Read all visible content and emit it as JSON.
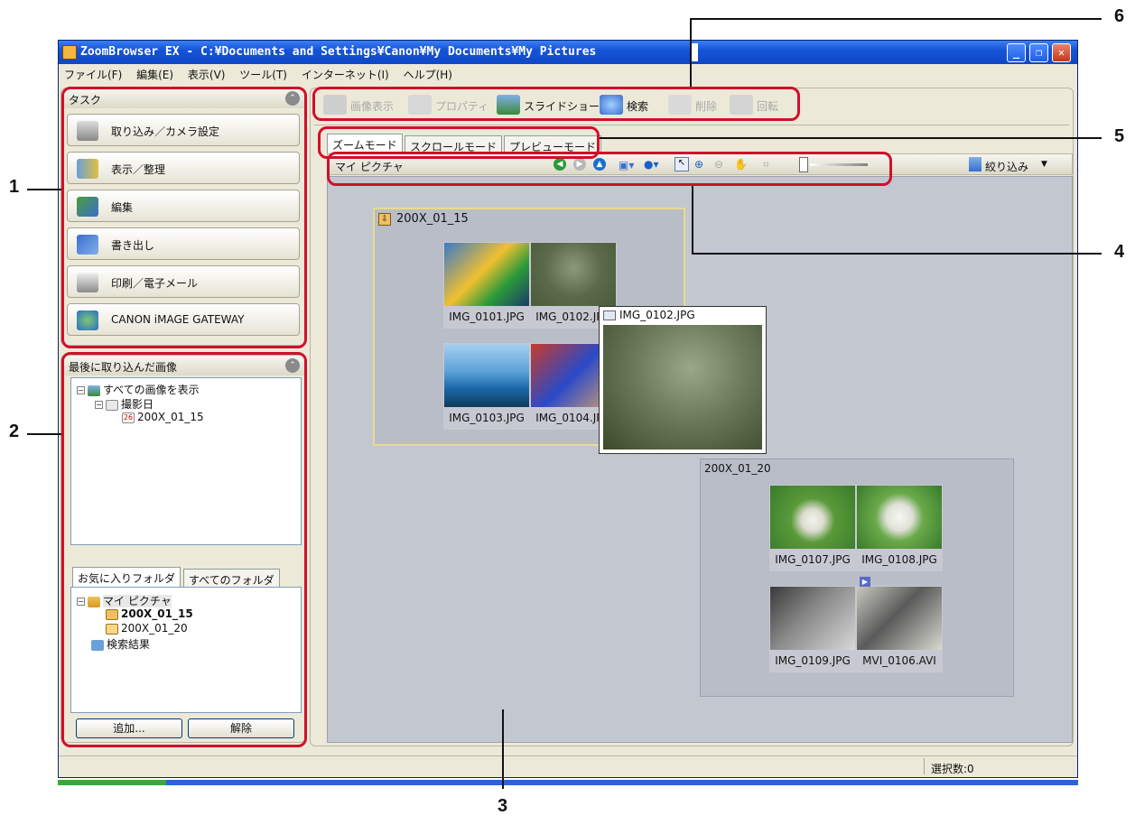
{
  "window": {
    "title": "ZoomBrowser EX  -  C:¥Documents and Settings¥Canon¥My Documents¥My Pictures",
    "controls": {
      "minimize": "_",
      "restore": "❐",
      "close": "✕"
    }
  },
  "menubar": [
    "ファイル(F)",
    "編集(E)",
    "表示(V)",
    "ツール(T)",
    "インターネット(I)",
    "ヘルプ(H)"
  ],
  "task_panel": {
    "title": "タスク",
    "buttons": [
      {
        "label": "取り込み／カメラ設定",
        "icon": "camera-icon"
      },
      {
        "label": "表示／整理",
        "icon": "binder-icon"
      },
      {
        "label": "編集",
        "icon": "edit-image-icon"
      },
      {
        "label": "書き出し",
        "icon": "export-icon"
      },
      {
        "label": "印刷／電子メール",
        "icon": "printer-icon"
      },
      {
        "label": "CANON iMAGE GATEWAY",
        "icon": "gateway-icon"
      }
    ]
  },
  "recent_panel": {
    "title": "最後に取り込んだ画像",
    "tree": {
      "root": "すべての画像を表示",
      "child": "撮影日",
      "leaf": "200X_01_15",
      "leaf_icon_text": "26"
    }
  },
  "folder_panel": {
    "tabs": [
      "お気に入りフォルダ",
      "すべてのフォルダ"
    ],
    "tree": {
      "root": "マイ ピクチャ",
      "children": [
        "200X_01_15",
        "200X_01_20"
      ],
      "search": "検索結果"
    },
    "buttons": {
      "add": "追加...",
      "remove": "解除"
    }
  },
  "main_toolbar": [
    {
      "label": "画像表示",
      "enabled": false
    },
    {
      "label": "プロパティ",
      "enabled": false
    },
    {
      "label": "スライドショー",
      "enabled": true
    },
    {
      "label": "検索",
      "enabled": true
    },
    {
      "label": "削除",
      "enabled": false
    },
    {
      "label": "回転",
      "enabled": false
    }
  ],
  "mode_tabs": [
    "ズームモード",
    "スクロールモード",
    "プレビューモード"
  ],
  "address": {
    "path": "マイ ピクチャ",
    "filter_label": "絞り込み"
  },
  "groups": [
    {
      "name": "200X_01_15",
      "images": [
        "IMG_0101.JPG",
        "IMG_0102.JPG",
        "IMG_0103.JPG",
        "IMG_0104.JPG"
      ]
    },
    {
      "name": "200X_01_20",
      "images": [
        "IMG_0107.JPG",
        "IMG_0108.JPG",
        "IMG_0109.JPG",
        "MVI_0106.AVI"
      ]
    }
  ],
  "preview_popup": {
    "filename": "IMG_0102.JPG"
  },
  "statusbar": {
    "selection": "選択数:0"
  },
  "callouts": [
    "1",
    "2",
    "3",
    "4",
    "5",
    "6"
  ],
  "colors": {
    "callout": "#d0102a",
    "title_bar": "#1554d8",
    "highlight_border": "#e8dc8a"
  }
}
